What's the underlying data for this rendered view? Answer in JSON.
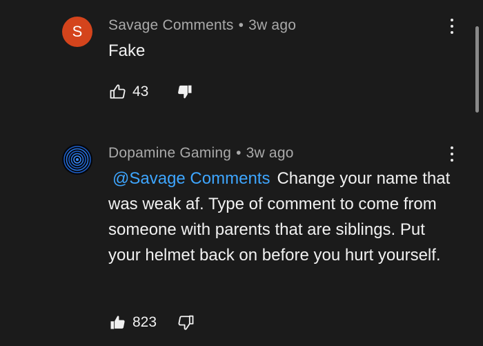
{
  "comments": [
    {
      "author": "Savage Comments",
      "separator": "•",
      "time": "3w ago",
      "avatar_letter": "S",
      "avatar_color": "#d4441c",
      "text": "Fake",
      "like_count": "43",
      "liked": false,
      "disliked": true
    },
    {
      "author": "Dopamine Gaming",
      "separator": "•",
      "time": "3w ago",
      "mention": "@Savage Comments",
      "text": "Change your name that was weak af. Type of comment to come from someone with parents that are siblings. Put your helmet back on before you hurt yourself.",
      "like_count": "823",
      "liked": true,
      "disliked": false
    }
  ],
  "colors": {
    "background": "#1b1b1b",
    "mention": "#3ea6ff",
    "meta": "#aaaaaa"
  },
  "icons": [
    "thumbs-up-icon",
    "thumbs-down-icon",
    "more-vertical-icon",
    "channel-avatar"
  ]
}
